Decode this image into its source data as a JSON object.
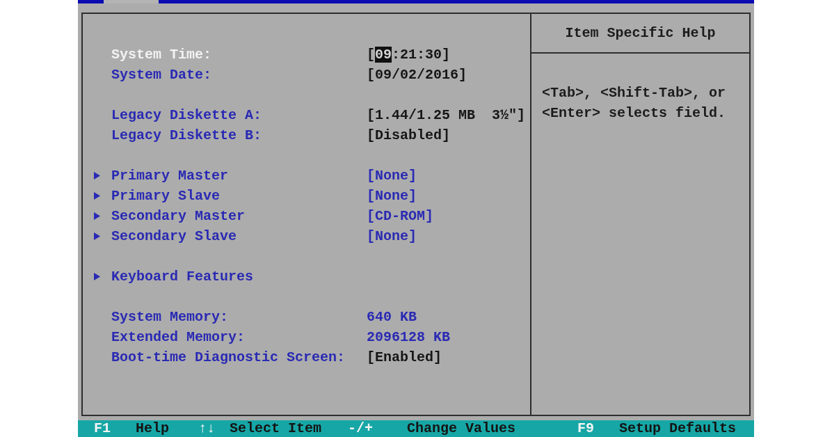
{
  "menu_bar": {
    "tabs": [
      {
        "selected": true
      }
    ]
  },
  "main": {
    "groups": [
      {
        "items": [
          {
            "kind": "field",
            "label": "System Time:",
            "selected": true,
            "editable": true,
            "value_segments": [
              {
                "text": "[",
                "cursor": false
              },
              {
                "text": "09",
                "cursor": true
              },
              {
                "text": ":21:30]",
                "cursor": false
              }
            ]
          },
          {
            "kind": "field",
            "label": "System Date:",
            "selected": false,
            "editable": true,
            "value": "[09/02/2016]"
          }
        ]
      },
      {
        "items": [
          {
            "kind": "field",
            "label": "Legacy Diskette A:",
            "selected": false,
            "editable": true,
            "value": "[1.44/1.25 MB  3½\"]"
          },
          {
            "kind": "field",
            "label": "Legacy Diskette B:",
            "selected": false,
            "editable": true,
            "value": "[Disabled]"
          }
        ]
      },
      {
        "items": [
          {
            "kind": "submenu",
            "label": "Primary Master",
            "selected": false,
            "editable": false,
            "value": "[None]"
          },
          {
            "kind": "submenu",
            "label": "Primary Slave",
            "selected": false,
            "editable": false,
            "value": "[None]"
          },
          {
            "kind": "submenu",
            "label": "Secondary Master",
            "selected": false,
            "editable": false,
            "value": "[CD-ROM]"
          },
          {
            "kind": "submenu",
            "label": "Secondary Slave",
            "selected": false,
            "editable": false,
            "value": "[None]"
          }
        ]
      },
      {
        "items": [
          {
            "kind": "submenu",
            "label": "Keyboard Features",
            "selected": false
          }
        ]
      },
      {
        "items": [
          {
            "kind": "field",
            "label": "System Memory:",
            "selected": false,
            "editable": false,
            "value": "640 KB"
          },
          {
            "kind": "field",
            "label": "Extended Memory:",
            "selected": false,
            "editable": false,
            "value": "2096128 KB"
          },
          {
            "kind": "field",
            "label": "Boot-time Diagnostic Screen:",
            "selected": false,
            "editable": true,
            "value": "[Enabled]"
          }
        ]
      }
    ]
  },
  "help_panel": {
    "title": "Item Specific Help",
    "text": "<Tab>, <Shift-Tab>, or <Enter> selects field."
  },
  "key_bar": [
    {
      "key": "F1",
      "action": "Help"
    },
    {
      "key": "↑↓",
      "action": "Select Item"
    },
    {
      "key": "-/+",
      "action": "Change Values"
    },
    {
      "key": "F9",
      "action": "Setup Defaults"
    }
  ]
}
